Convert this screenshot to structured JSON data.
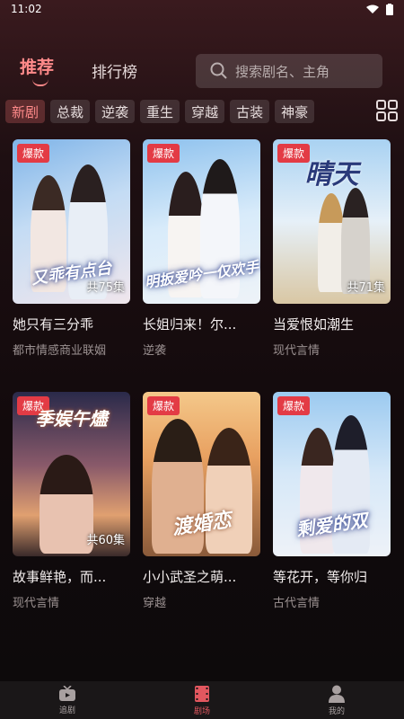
{
  "status": {
    "time": "11:02"
  },
  "header": {
    "tab_recommend": "推荐",
    "tab_ranking": "排行榜",
    "search_placeholder": "搜索剧名、主角"
  },
  "categories": [
    "新剧",
    "总裁",
    "逆袭",
    "重生",
    "穿越",
    "古装",
    "神豪"
  ],
  "cards": [
    {
      "badge": "爆款",
      "title": "她只有三分乖",
      "tag": "都市情感商业联姻",
      "episodes": "共75集",
      "poster_text": "又乖有点台"
    },
    {
      "badge": "爆款",
      "title": "长姐归来！尔...",
      "tag": "逆袭",
      "episodes": "",
      "poster_text": "明扳爱吟一仅欢手"
    },
    {
      "badge": "爆款",
      "title": "当爱恨如潮生",
      "tag": "现代言情",
      "episodes": "共71集",
      "poster_text": "晴天"
    },
    {
      "badge": "爆款",
      "title": "故事鲜艳，而...",
      "tag": "现代言情",
      "episodes": "共60集",
      "poster_text": "季娱午燼"
    },
    {
      "badge": "爆款",
      "title": "小小武圣之萌...",
      "tag": "穿越",
      "episodes": "",
      "poster_text": "渡婚恋"
    },
    {
      "badge": "爆款",
      "title": "等花开，等你归",
      "tag": "古代言情",
      "episodes": "",
      "poster_text": "剩爱的双"
    }
  ],
  "tabbar": [
    {
      "label": "追剧",
      "icon": "tv-icon"
    },
    {
      "label": "剧场",
      "icon": "film-icon"
    },
    {
      "label": "我的",
      "icon": "person-icon"
    }
  ],
  "colors": {
    "accent": "#ff8a8a",
    "badge": "#e33b45",
    "active_tab": "#e2575f"
  }
}
